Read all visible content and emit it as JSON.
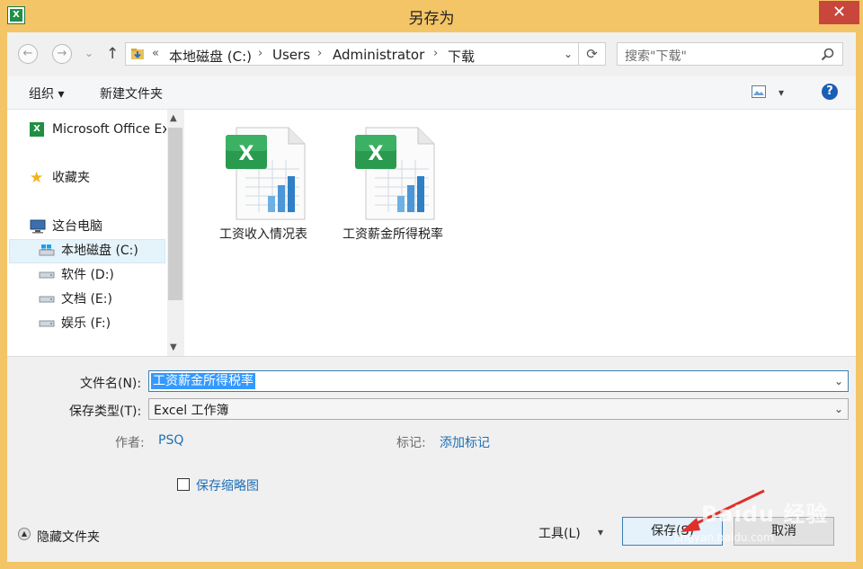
{
  "window": {
    "title": "另存为",
    "close_glyph": "✕",
    "icon": "excel-icon"
  },
  "address": {
    "back_glyph": "←",
    "forward_glyph": "→",
    "dropdown_glyph": "⌄",
    "up_glyph": "↑",
    "overflow": "«",
    "crumbs": [
      "本地磁盘 (C:)",
      "Users",
      "Administrator",
      "下载"
    ],
    "sep": "›",
    "refresh_glyph": "⟳"
  },
  "search": {
    "placeholder": "搜索\"下载\""
  },
  "toolbar": {
    "organize": "组织 ▾",
    "new_folder": "新建文件夹",
    "help_glyph": "?"
  },
  "nav": {
    "items": [
      {
        "label": "Microsoft Office Ex",
        "icon": "excel-icon"
      },
      {
        "label": "收藏夹",
        "icon": "star-icon"
      },
      {
        "label": "这台电脑",
        "icon": "computer-icon"
      },
      {
        "label": "本地磁盘 (C:)",
        "icon": "windows-drive-icon",
        "selected": true
      },
      {
        "label": "软件 (D:)",
        "icon": "drive-icon"
      },
      {
        "label": "文档 (E:)",
        "icon": "drive-icon"
      },
      {
        "label": "娱乐 (F:)",
        "icon": "drive-icon"
      }
    ]
  },
  "files": [
    {
      "name": "工资收入情况表"
    },
    {
      "name": "工资薪金所得税率"
    }
  ],
  "form": {
    "filename_label": "文件名(N):",
    "filename_value": "工资薪金所得税率",
    "filetype_label": "保存类型(T):",
    "filetype_value": "Excel 工作簿",
    "author_label": "作者:",
    "author_value": "PSQ",
    "tags_label": "标记:",
    "tags_value": "添加标记",
    "thumbnail_label": "保存缩略图"
  },
  "footer": {
    "hide_folders": "隐藏文件夹",
    "tools": "工具(L)",
    "save": "保存(S)",
    "cancel": "取消"
  },
  "watermark": {
    "text": "Baidu 经验",
    "url": "jingyan.baidu.com"
  },
  "colors": {
    "accent": "#0078d7",
    "selection": "#3399ff",
    "window_frame": "#f4c567",
    "close": "#c8463b"
  }
}
